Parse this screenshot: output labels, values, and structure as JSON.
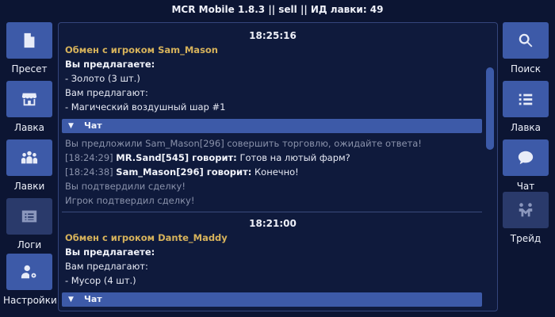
{
  "window": {
    "title": "MCR Mobile 1.8.3 || sell || ИД лавки: 49"
  },
  "left_nav": [
    {
      "label": "Пресет",
      "icon": "file-icon"
    },
    {
      "label": "Лавка",
      "icon": "shop-icon"
    },
    {
      "label": "Лавки",
      "icon": "group-icon"
    },
    {
      "label": "Логи",
      "icon": "list-card-icon"
    },
    {
      "label": "Настройки",
      "icon": "user-gear-icon"
    }
  ],
  "right_nav": [
    {
      "label": "Поиск",
      "icon": "search-icon"
    },
    {
      "label": "Лавка",
      "icon": "list-icon"
    },
    {
      "label": "Чат",
      "icon": "chat-bubble-icon"
    },
    {
      "label": "Трейд",
      "icon": "handshake-icon"
    }
  ],
  "trades": [
    {
      "time": "18:25:16",
      "header": "Обмен с игроком Sam_Mason",
      "you_offer_label": "Вы предлагаете:",
      "you_offer_items": [
        " - Золото (3 шт.)"
      ],
      "they_offer_label": "Вам предлагают:",
      "they_offer_items": [
        " - Магический воздушный шар #1"
      ],
      "chat_label": "Чат",
      "chat": {
        "system_top": "Вы предложили Sam_Mason[296] совершить торговлю, ожидайте ответа!",
        "messages": [
          {
            "ts": "[18:24:29]",
            "speaker": "MR.Sand[545] говорит:",
            "text": "Готов на лютый фарм?"
          },
          {
            "ts": "[18:24:38]",
            "speaker": "Sam_Mason[296] говорит:",
            "text": "Конечно!"
          }
        ],
        "system_bottom": [
          "Вы подтвердили сделку!",
          "Игрок подтвердил сделку!"
        ]
      }
    },
    {
      "time": "18:21:00",
      "header": "Обмен с игроком Dante_Maddy",
      "you_offer_label": "Вы предлагаете:",
      "they_offer_label": "Вам предлагают:",
      "they_offer_items": [
        " - Мусор (4 шт.)"
      ],
      "chat_label": "Чат"
    }
  ]
}
